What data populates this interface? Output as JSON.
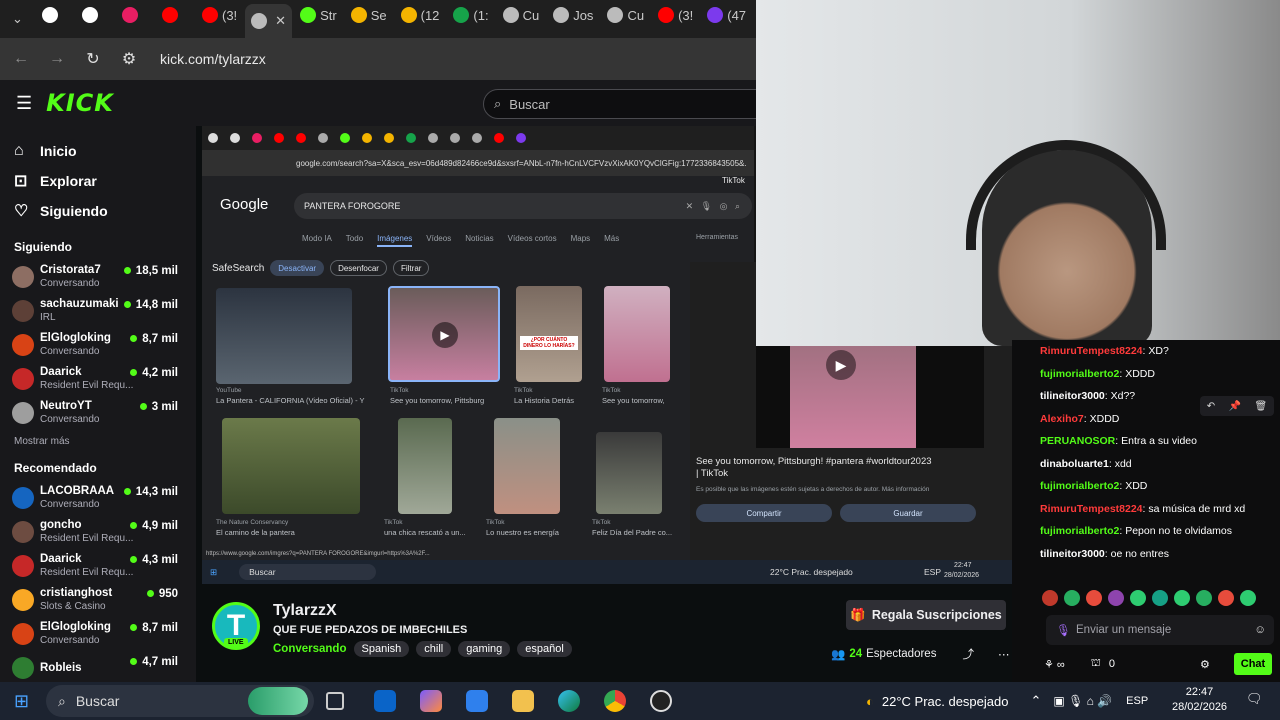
{
  "browser": {
    "tabs": [
      {
        "label": "",
        "color": "#ffffff"
      },
      {
        "label": "",
        "color": "#ffffff"
      },
      {
        "label": "",
        "color": "#e91e63"
      },
      {
        "label": "",
        "color": "#ff0000"
      },
      {
        "label": "(3!",
        "color": "#ff0000"
      },
      {
        "label": "",
        "color": "#bbbbbb"
      },
      {
        "label": "Str",
        "color": "#53fc18"
      },
      {
        "label": "Se",
        "color": "#f4b400"
      },
      {
        "label": "(12",
        "color": "#f4b400"
      },
      {
        "label": "(1:",
        "color": "#16a34a"
      },
      {
        "label": "Cu",
        "color": "#bbbbbb"
      },
      {
        "label": "Jos",
        "color": "#bbbbbb"
      },
      {
        "label": "Cu",
        "color": "#bbbbbb"
      },
      {
        "label": "(3!",
        "color": "#ff0000"
      },
      {
        "label": "(47",
        "color": "#7c3aed"
      }
    ],
    "url": "kick.com/tylarzzx"
  },
  "kick": {
    "logo": "KICK",
    "search_placeholder": "Buscar",
    "nav": [
      {
        "label": "Inicio",
        "icon": "home-icon"
      },
      {
        "label": "Explorar",
        "icon": "compass-icon"
      },
      {
        "label": "Siguiendo",
        "icon": "heart-icon"
      }
    ],
    "following_title": "Siguiendo",
    "following": [
      {
        "name": "Cristorata7",
        "sub": "Conversando",
        "count": "18,5 mil",
        "color": "#8d6e63"
      },
      {
        "name": "sachauzumaki",
        "sub": "IRL",
        "count": "14,8 mil",
        "color": "#5d4037"
      },
      {
        "name": "ElGlogloking",
        "sub": "Conversando",
        "count": "8,7 mil",
        "color": "#d84315"
      },
      {
        "name": "Daarick",
        "sub": "Resident Evil Requ...",
        "count": "4,2 mil",
        "color": "#c62828"
      },
      {
        "name": "NeutroYT",
        "sub": "Conversando",
        "count": "3 mil",
        "color": "#9e9e9e"
      }
    ],
    "show_more": "Mostrar más",
    "recommended_title": "Recomendado",
    "recommended": [
      {
        "name": "LACOBRAAA",
        "sub": "Conversando",
        "count": "14,3 mil",
        "color": "#1565c0"
      },
      {
        "name": "goncho",
        "sub": "Resident Evil Requ...",
        "count": "4,9 mil",
        "color": "#6d4c41"
      },
      {
        "name": "Daarick",
        "sub": "Resident Evil Requ...",
        "count": "4,3 mil",
        "color": "#c62828"
      },
      {
        "name": "cristianghost",
        "sub": "Slots & Casino",
        "count": "950",
        "color": "#f9a825"
      },
      {
        "name": "ElGlogloking",
        "sub": "Conversando",
        "count": "8,7 mil",
        "color": "#d84315"
      },
      {
        "name": "Robleis",
        "sub": "",
        "count": "4,7 mil",
        "color": "#2e7d32"
      }
    ]
  },
  "stream": {
    "google": {
      "url": "google.com/search?sa=X&sca_esv=06d489d82466ce9d&sxsrf=ANbL-n7fn-hCnLVCFVzvXixAK0YQvClGFig:1772336843505&...",
      "logo": "Google",
      "query": "PANTERA FOROGORE",
      "tabs": [
        "Modo IA",
        "Todo",
        "Imágenes",
        "Vídeos",
        "Noticias",
        "Vídeos cortos",
        "Maps",
        "Más"
      ],
      "tools": "Herramientas",
      "safesearch": "SafeSearch",
      "filters": [
        "Desactivar",
        "Desenfocar",
        "Filtrar"
      ],
      "results_row1": [
        {
          "source": "YouTube",
          "caption": "La Pantera - CALIFORNIA (Video Oficial) - Y"
        },
        {
          "source": "TikTok",
          "caption": "See you tomorrow, Pittsburg"
        },
        {
          "source": "TikTok",
          "caption": "La Historia Detrás"
        },
        {
          "source": "TikTok",
          "caption": "See you tomorrow,"
        }
      ],
      "results_row2": [
        {
          "source": "The Nature Conservancy",
          "caption": "El camino de la pantera"
        },
        {
          "source": "TikTok",
          "caption": "una chica rescató a un..."
        },
        {
          "source": "TikTok",
          "caption": "Lo nuestro es energía"
        },
        {
          "source": "TikTok",
          "caption": "Feliz Día del Padre co..."
        }
      ],
      "preview_source": "TikTok",
      "preview_title": "See you tomorrow, Pittsburgh! #pantera #worldtour2023 | TikTok",
      "preview_note": "Es posible que las imágenes estén sujetas a derechos de autor. Más información",
      "preview_buttons": [
        "Compartir",
        "Guardar"
      ],
      "status_url": "https://www.google.com/imgres?q=PANTERA FOROGORE&imgurl=https%3A%2F...",
      "thumb_caption": "¿POR CUÁNTO DINERO LO HARÍAS?"
    },
    "inner_taskbar": {
      "search": "Buscar",
      "weather": "22°C Prac. despejado",
      "lang": "ESP",
      "time": "22:47",
      "date": "28/02/2026"
    }
  },
  "chat": {
    "messages": [
      {
        "user": "RimuruTempest8224",
        "text": "XD?",
        "color": "#ff3b3b"
      },
      {
        "user": "fujimorialberto2",
        "text": "XDDD",
        "color": "#53fc18"
      },
      {
        "user": "tilineitor3000",
        "text": "Xd??",
        "color": "#ffffff"
      },
      {
        "user": "Alexiho7",
        "text": "XDDD",
        "color": "#ff3b3b"
      },
      {
        "user": "PERUANOSOR",
        "text": "Entra a su video",
        "color": "#53fc18"
      },
      {
        "user": "dinaboluarte1",
        "text": "xdd",
        "color": "#ffffff"
      },
      {
        "user": "fujimorialberto2",
        "text": "XDD",
        "color": "#53fc18"
      },
      {
        "user": "RimuruTempest8224",
        "text": "sa música de mrd xd",
        "color": "#ff3b3b"
      },
      {
        "user": "fujimorialberto2",
        "text": "Pepon no te olvidamos",
        "color": "#53fc18"
      },
      {
        "user": "tilineitor3000",
        "text": "oe no entres",
        "color": "#ffffff"
      }
    ],
    "input_placeholder": "Enviar un mensaje",
    "count": "0",
    "send_label": "Chat"
  },
  "streamer": {
    "name": "TylarzzX",
    "live": "LIVE",
    "title": "QUE FUE PEDAZOS DE IMBECHILES",
    "category": "Conversando",
    "tags": [
      "Spanish",
      "chill",
      "gaming",
      "español"
    ],
    "subs_button": "Regala Suscripciones",
    "viewers": "24",
    "viewers_label": "Espectadores"
  },
  "taskbar": {
    "search": "Buscar",
    "weather": "22°C Prac. despejado",
    "lang": "ESP",
    "time": "22:47",
    "date": "28/02/2026"
  }
}
